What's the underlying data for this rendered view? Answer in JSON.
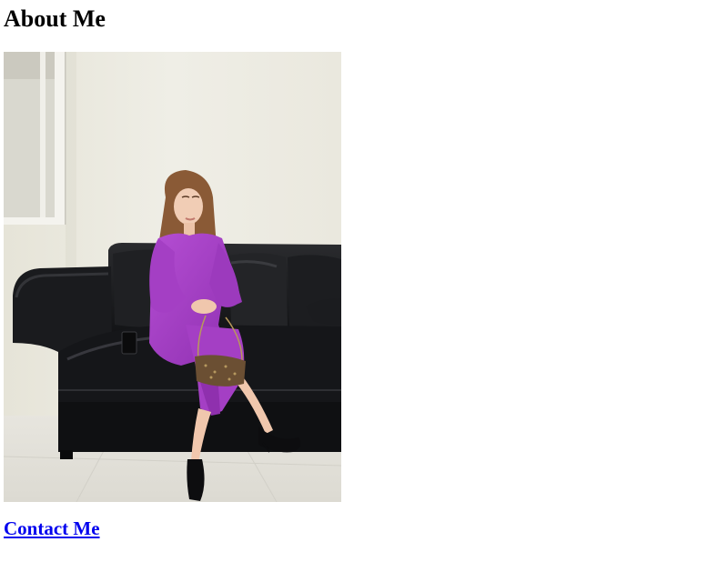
{
  "page": {
    "heading": "About Me",
    "link": {
      "label": "Contact Me"
    }
  },
  "photo": {
    "subject": "woman in purple outfit seated on black leather sofa",
    "colors": {
      "wall": "#eceae0",
      "floor": "#e3e1da",
      "sofa": "#17181a",
      "outfit": "#a43fc4",
      "shoes": "#0d0d0f",
      "bag": "#6b4f33"
    }
  },
  "colors": {
    "link": "#0000ee",
    "text": "#000000",
    "background": "#ffffff"
  }
}
